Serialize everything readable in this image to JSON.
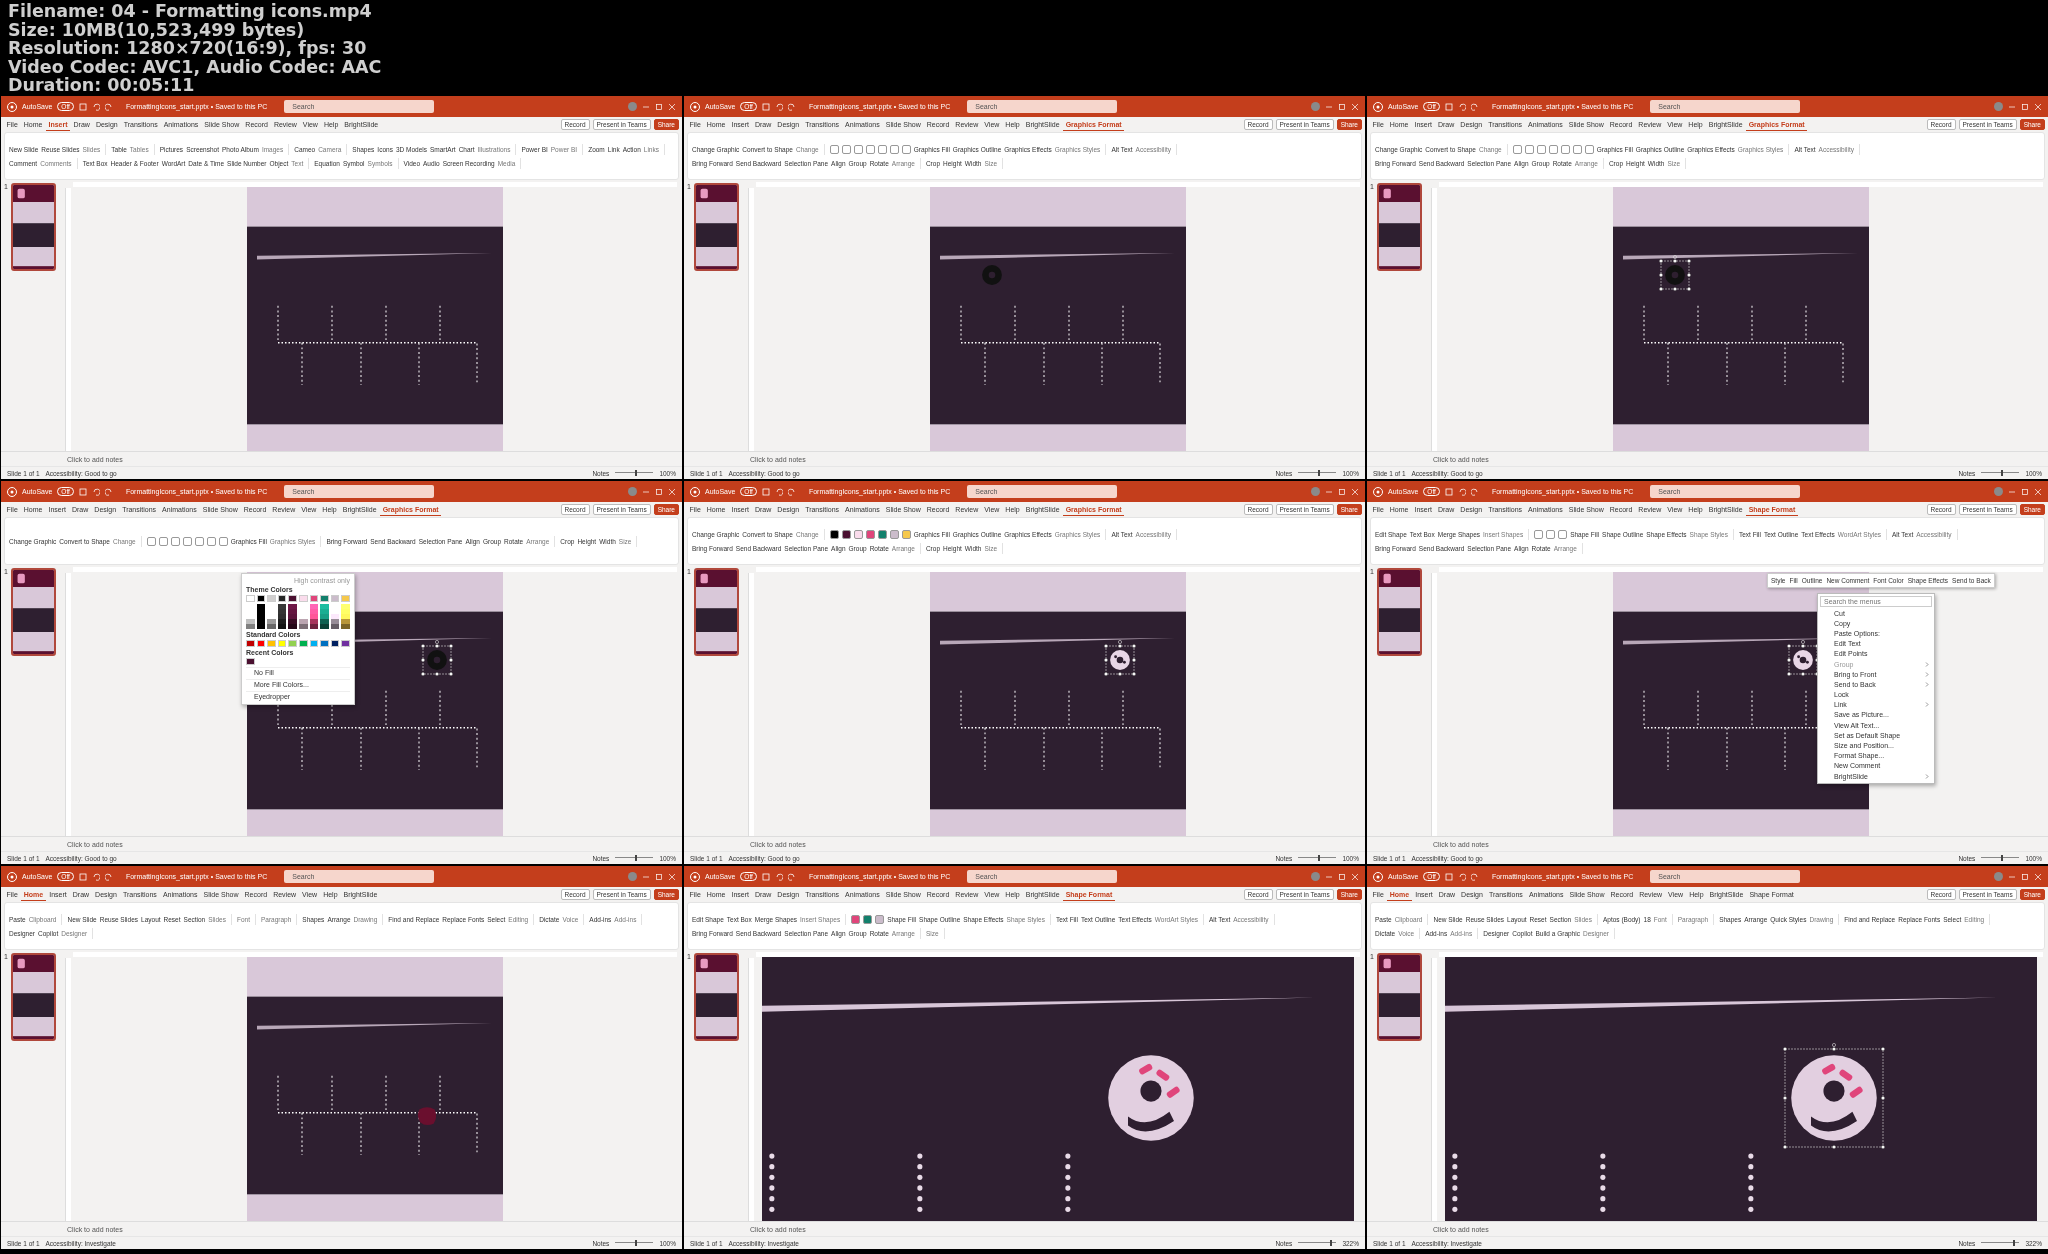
{
  "info_lines": [
    "Filename: 04 - Formatting icons.mp4",
    "Size: 10MB(10,523,499 bytes)",
    "Resolution: 1280×720(16:9), fps: 30",
    "Video Codec: AVC1, Audio Codec: AAC",
    "Duration: 00:05:11"
  ],
  "frames": [
    {
      "autosave": "AutoSave",
      "autosave_state": "Off",
      "title": "FormattingIcons_start.pptx • Saved to this PC",
      "search_placeholder": "Search",
      "tabs": [
        {
          "label": "File",
          "selected": false
        },
        {
          "label": "Home",
          "selected": false
        },
        {
          "label": "Insert",
          "selected": true
        },
        {
          "label": "Draw",
          "selected": false
        },
        {
          "label": "Design",
          "selected": false
        },
        {
          "label": "Transitions",
          "selected": false
        },
        {
          "label": "Animations",
          "selected": false
        },
        {
          "label": "Slide Show",
          "selected": false
        },
        {
          "label": "Record",
          "selected": false
        },
        {
          "label": "Review",
          "selected": false
        },
        {
          "label": "View",
          "selected": false
        },
        {
          "label": "Help",
          "selected": false
        },
        {
          "label": "BrightSlide",
          "selected": false
        }
      ],
      "actions": [
        "Record",
        "Present in Teams",
        "Share"
      ],
      "ribbon": [
        {
          "label": "Slides",
          "items": [
            "New Slide",
            "Reuse Slides"
          ]
        },
        {
          "label": "Tables",
          "items": [
            "Table"
          ]
        },
        {
          "label": "Images",
          "items": [
            "Pictures",
            "Screenshot",
            "Photo Album"
          ]
        },
        {
          "label": "Camera",
          "items": [
            "Cameo"
          ]
        },
        {
          "label": "Illustrations",
          "items": [
            "Shapes",
            "Icons",
            "3D Models",
            "SmartArt",
            "Chart"
          ]
        },
        {
          "label": "Power BI",
          "items": [
            "Power BI"
          ]
        },
        {
          "label": "Links",
          "items": [
            "Zoom",
            "Link",
            "Action"
          ]
        },
        {
          "label": "Comments",
          "items": [
            "Comment"
          ]
        },
        {
          "label": "Text",
          "items": [
            "Text Box",
            "Header & Footer",
            "WordArt",
            "Date & Time",
            "Slide Number",
            "Object"
          ]
        },
        {
          "label": "Symbols",
          "items": [
            "Equation",
            "Symbol"
          ]
        },
        {
          "label": "Media",
          "items": [
            "Video",
            "Audio",
            "Screen Recording"
          ]
        }
      ],
      "slide": {
        "kind": "fit"
      },
      "thumb_number": "1",
      "notes_placeholder": "Click to add notes",
      "slide_count": "Slide 1 of 1",
      "accessibility": "Accessibility: Good to go",
      "notes_button": "Notes",
      "zoom_slider": {
        "level": 0.55
      },
      "zoom": "100%"
    },
    {
      "autosave": "AutoSave",
      "autosave_state": "Off",
      "title": "FormattingIcons_start.pptx • Saved to this PC",
      "search_placeholder": "Search",
      "tabs": [
        {
          "label": "File",
          "selected": false
        },
        {
          "label": "Home",
          "selected": false
        },
        {
          "label": "Insert",
          "selected": false
        },
        {
          "label": "Draw",
          "selected": false
        },
        {
          "label": "Design",
          "selected": false
        },
        {
          "label": "Transitions",
          "selected": false
        },
        {
          "label": "Animations",
          "selected": false
        },
        {
          "label": "Slide Show",
          "selected": false
        },
        {
          "label": "Record",
          "selected": false
        },
        {
          "label": "Review",
          "selected": false
        },
        {
          "label": "View",
          "selected": false
        },
        {
          "label": "Help",
          "selected": false
        },
        {
          "label": "BrightSlide",
          "selected": false
        },
        {
          "label": "Graphics Format",
          "selected": true
        }
      ],
      "actions": [
        "Record",
        "Present in Teams",
        "Share"
      ],
      "ribbon": [
        {
          "label": "Change",
          "items": [
            "Change Graphic",
            "Convert to Shape"
          ]
        },
        {
          "label": "Graphics Styles",
          "swatches": [
            {
              "color": "#ffffff"
            },
            {
              "color": "#ffffff"
            },
            {
              "color": "#ffffff"
            },
            {
              "color": "#ffffff"
            },
            {
              "color": "#ffffff"
            },
            {
              "color": "#ffffff"
            },
            {
              "color": "#ffffff"
            }
          ],
          "items": [
            "Graphics Fill",
            "Graphics Outline",
            "Graphics Effects"
          ]
        },
        {
          "label": "Accessibility",
          "items": [
            "Alt Text"
          ]
        },
        {
          "label": "Arrange",
          "items": [
            "Bring Forward",
            "Send Backward",
            "Selection Pane",
            "Align",
            "Group",
            "Rotate"
          ]
        },
        {
          "label": "Size",
          "items": [
            "Crop",
            "Height",
            "Width"
          ]
        }
      ],
      "slide": {
        "kind": "fit",
        "icon": {
          "kind": "dark",
          "selected": false
        }
      },
      "thumb_number": "1",
      "notes_placeholder": "Click to add notes",
      "slide_count": "Slide 1 of 1",
      "accessibility": "Accessibility: Good to go",
      "notes_button": "Notes",
      "zoom_slider": {
        "level": 0.55
      },
      "zoom": "100%"
    },
    {
      "autosave": "AutoSave",
      "autosave_state": "Off",
      "title": "FormattingIcons_start.pptx • Saved to this PC",
      "search_placeholder": "Search",
      "tabs": [
        {
          "label": "File",
          "selected": false
        },
        {
          "label": "Home",
          "selected": false
        },
        {
          "label": "Insert",
          "selected": false
        },
        {
          "label": "Draw",
          "selected": false
        },
        {
          "label": "Design",
          "selected": false
        },
        {
          "label": "Transitions",
          "selected": false
        },
        {
          "label": "Animations",
          "selected": false
        },
        {
          "label": "Slide Show",
          "selected": false
        },
        {
          "label": "Record",
          "selected": false
        },
        {
          "label": "Review",
          "selected": false
        },
        {
          "label": "View",
          "selected": false
        },
        {
          "label": "Help",
          "selected": false
        },
        {
          "label": "BrightSlide",
          "selected": false
        },
        {
          "label": "Graphics Format",
          "selected": true
        }
      ],
      "actions": [
        "Record",
        "Present in Teams",
        "Share"
      ],
      "ribbon": [
        {
          "label": "Change",
          "items": [
            "Change Graphic",
            "Convert to Shape"
          ]
        },
        {
          "label": "Graphics Styles",
          "swatches": [
            {
              "color": "#ffffff"
            },
            {
              "color": "#ffffff"
            },
            {
              "color": "#ffffff"
            },
            {
              "color": "#ffffff"
            },
            {
              "color": "#ffffff"
            },
            {
              "color": "#ffffff"
            },
            {
              "color": "#ffffff"
            }
          ],
          "items": [
            "Graphics Fill",
            "Graphics Outline",
            "Graphics Effects"
          ]
        },
        {
          "label": "Accessibility",
          "items": [
            "Alt Text"
          ]
        },
        {
          "label": "Arrange",
          "items": [
            "Bring Forward",
            "Send Backward",
            "Selection Pane",
            "Align",
            "Group",
            "Rotate"
          ]
        },
        {
          "label": "Size",
          "items": [
            "Crop",
            "Height",
            "Width"
          ]
        }
      ],
      "slide": {
        "kind": "fit",
        "icon": {
          "kind": "dark",
          "selected": true
        }
      },
      "thumb_number": "1",
      "notes_placeholder": "Click to add notes",
      "slide_count": "Slide 1 of 1",
      "accessibility": "Accessibility: Good to go",
      "notes_button": "Notes",
      "zoom_slider": {
        "level": 0.55
      },
      "zoom": "100%"
    },
    {
      "autosave": "AutoSave",
      "autosave_state": "Off",
      "title": "FormattingIcons_start.pptx • Saved to this PC",
      "search_placeholder": "Search",
      "tabs": [
        {
          "label": "File",
          "selected": false
        },
        {
          "label": "Home",
          "selected": false
        },
        {
          "label": "Insert",
          "selected": false
        },
        {
          "label": "Draw",
          "selected": false
        },
        {
          "label": "Design",
          "selected": false
        },
        {
          "label": "Transitions",
          "selected": false
        },
        {
          "label": "Animations",
          "selected": false
        },
        {
          "label": "Slide Show",
          "selected": false
        },
        {
          "label": "Record",
          "selected": false
        },
        {
          "label": "Review",
          "selected": false
        },
        {
          "label": "View",
          "selected": false
        },
        {
          "label": "Help",
          "selected": false
        },
        {
          "label": "BrightSlide",
          "selected": false
        },
        {
          "label": "Graphics Format",
          "selected": true
        }
      ],
      "actions": [
        "Record",
        "Present in Teams",
        "Share"
      ],
      "ribbon": [
        {
          "label": "Change",
          "items": [
            "Change Graphic",
            "Convert to Shape"
          ]
        },
        {
          "label": "Graphics Styles",
          "swatches": [
            {
              "color": "#ffffff"
            },
            {
              "color": "#ffffff"
            },
            {
              "color": "#ffffff"
            },
            {
              "color": "#ffffff"
            },
            {
              "color": "#ffffff"
            },
            {
              "color": "#ffffff"
            },
            {
              "color": "#ffffff"
            }
          ],
          "items": [
            "Graphics Fill"
          ]
        },
        {
          "label": "Arrange",
          "items": [
            "Bring Forward",
            "Send Backward",
            "Selection Pane",
            "Align",
            "Group",
            "Rotate"
          ]
        },
        {
          "label": "Size",
          "items": [
            "Crop",
            "Height",
            "Width"
          ]
        }
      ],
      "slide": {
        "kind": "fit",
        "icon": {
          "kind": "dark",
          "selected": true
        }
      },
      "thumb_number": "1",
      "notes_placeholder": "Click to add notes",
      "slide_count": "Slide 1 of 1",
      "accessibility": "Accessibility: Good to go",
      "notes_button": "Notes",
      "zoom_slider": {
        "level": 0.55
      },
      "zoom": "100%",
      "popup": {
        "kind": "palette",
        "toggle_label": "High contrast only",
        "theme_heading": "Theme Colors",
        "theme_colors": [
          {
            "color": "#ffffff"
          },
          {
            "color": "#000000"
          },
          {
            "color": "#d0cece"
          },
          {
            "color": "#262626"
          },
          {
            "color": "#4a1030"
          },
          {
            "color": "#fadcec"
          },
          {
            "color": "#e0457b"
          },
          {
            "color": "#13806c"
          },
          {
            "color": "#cbbccb"
          },
          {
            "color": "#f5c84c"
          }
        ],
        "standard_heading": "Standard Colors",
        "standard_colors": [
          {
            "color": "#c00000"
          },
          {
            "color": "#ff0000"
          },
          {
            "color": "#ffc000"
          },
          {
            "color": "#ffff00"
          },
          {
            "color": "#92d050"
          },
          {
            "color": "#00b050"
          },
          {
            "color": "#00b0f0"
          },
          {
            "color": "#0070c0"
          },
          {
            "color": "#002060"
          },
          {
            "color": "#7030a0"
          }
        ],
        "recent_heading": "Recent Colors",
        "recent_colors": [
          {
            "color": "#4a1030"
          }
        ],
        "commands": [
          "No Fill",
          "More Fill Colors...",
          "Eyedropper"
        ]
      }
    },
    {
      "autosave": "AutoSave",
      "autosave_state": "Off",
      "title": "FormattingIcons_start.pptx • Saved to this PC",
      "search_placeholder": "Search",
      "tabs": [
        {
          "label": "File",
          "selected": false
        },
        {
          "label": "Home",
          "selected": false
        },
        {
          "label": "Insert",
          "selected": false
        },
        {
          "label": "Draw",
          "selected": false
        },
        {
          "label": "Design",
          "selected": false
        },
        {
          "label": "Transitions",
          "selected": false
        },
        {
          "label": "Animations",
          "selected": false
        },
        {
          "label": "Slide Show",
          "selected": false
        },
        {
          "label": "Record",
          "selected": false
        },
        {
          "label": "Review",
          "selected": false
        },
        {
          "label": "View",
          "selected": false
        },
        {
          "label": "Help",
          "selected": false
        },
        {
          "label": "BrightSlide",
          "selected": false
        },
        {
          "label": "Graphics Format",
          "selected": true
        }
      ],
      "actions": [
        "Record",
        "Present in Teams",
        "Share"
      ],
      "ribbon": [
        {
          "label": "Change",
          "items": [
            "Change Graphic",
            "Convert to Shape"
          ]
        },
        {
          "label": "Graphics Styles",
          "swatches": [
            {
              "color": "#000000"
            },
            {
              "color": "#4a1030"
            },
            {
              "color": "#fadcec"
            },
            {
              "color": "#e0457b"
            },
            {
              "color": "#13806c"
            },
            {
              "color": "#cbbccb"
            },
            {
              "color": "#f5c84c"
            }
          ],
          "items": [
            "Graphics Fill",
            "Graphics Outline",
            "Graphics Effects"
          ]
        },
        {
          "label": "Accessibility",
          "items": [
            "Alt Text"
          ]
        },
        {
          "label": "Arrange",
          "items": [
            "Bring Forward",
            "Send Backward",
            "Selection Pane",
            "Align",
            "Group",
            "Rotate"
          ]
        },
        {
          "label": "Size",
          "items": [
            "Crop",
            "Height",
            "Width"
          ]
        }
      ],
      "slide": {
        "kind": "fit",
        "icon": {
          "kind": "light",
          "selected": true
        }
      },
      "thumb_number": "1",
      "notes_placeholder": "Click to add notes",
      "slide_count": "Slide 1 of 1",
      "accessibility": "Accessibility: Good to go",
      "notes_button": "Notes",
      "zoom_slider": {
        "level": 0.55
      },
      "zoom": "100%"
    },
    {
      "autosave": "AutoSave",
      "autosave_state": "Off",
      "title": "FormattingIcons_start.pptx • Saved to this PC",
      "search_placeholder": "Search",
      "tabs": [
        {
          "label": "File",
          "selected": false
        },
        {
          "label": "Home",
          "selected": false
        },
        {
          "label": "Insert",
          "selected": false
        },
        {
          "label": "Draw",
          "selected": false
        },
        {
          "label": "Design",
          "selected": false
        },
        {
          "label": "Transitions",
          "selected": false
        },
        {
          "label": "Animations",
          "selected": false
        },
        {
          "label": "Slide Show",
          "selected": false
        },
        {
          "label": "Record",
          "selected": false
        },
        {
          "label": "Review",
          "selected": false
        },
        {
          "label": "View",
          "selected": false
        },
        {
          "label": "Help",
          "selected": false
        },
        {
          "label": "BrightSlide",
          "selected": false
        },
        {
          "label": "Shape Format",
          "selected": true
        }
      ],
      "actions": [
        "Record",
        "Present in Teams",
        "Share"
      ],
      "ribbon": [
        {
          "label": "Insert Shapes",
          "items": [
            "Edit Shape",
            "Text Box",
            "Merge Shapes"
          ]
        },
        {
          "label": "Shape Styles",
          "swatches": [
            {
              "color": "#ffffff"
            },
            {
              "color": "#ffffff"
            },
            {
              "color": "#ffffff"
            }
          ],
          "items": [
            "Shape Fill",
            "Shape Outline",
            "Shape Effects"
          ]
        },
        {
          "label": "WordArt Styles",
          "items": [
            "Text Fill",
            "Text Outline",
            "Text Effects"
          ]
        },
        {
          "label": "Accessibility",
          "items": [
            "Alt Text"
          ]
        },
        {
          "label": "Arrange",
          "items": [
            "Bring Forward",
            "Send Backward",
            "Selection Pane",
            "Align",
            "Rotate"
          ]
        }
      ],
      "slide": {
        "kind": "fit",
        "icon": {
          "kind": "light",
          "selected": true
        }
      },
      "thumb_number": "1",
      "notes_placeholder": "Click to add notes",
      "slide_count": "Slide 1 of 1",
      "accessibility": "Accessibility: Good to go",
      "notes_button": "Notes",
      "zoom_slider": {
        "level": 0.55
      },
      "zoom": "100%",
      "popup": {
        "kind": "context_menu",
        "mini_toolbar": [
          "Style",
          "Fill",
          "Outline",
          "New Comment",
          "Font Color",
          "Shape Effects",
          "Send to Back"
        ],
        "search_placeholder": "Search the menus",
        "items": [
          {
            "label": "Cut",
            "disabled": false,
            "submenu": false
          },
          {
            "label": "Copy",
            "disabled": false,
            "submenu": false
          },
          {
            "label": "Paste Options:",
            "disabled": false,
            "submenu": false
          },
          {
            "label": "Edit Text",
            "disabled": false,
            "submenu": false
          },
          {
            "label": "Edit Points",
            "disabled": false,
            "submenu": false
          },
          {
            "label": "Group",
            "disabled": true,
            "submenu": true
          },
          {
            "label": "Bring to Front",
            "disabled": false,
            "submenu": true
          },
          {
            "label": "Send to Back",
            "disabled": false,
            "submenu": true
          },
          {
            "label": "Lock",
            "disabled": false,
            "submenu": false
          },
          {
            "label": "Link",
            "disabled": false,
            "submenu": true
          },
          {
            "label": "Save as Picture...",
            "disabled": false,
            "submenu": false
          },
          {
            "label": "View Alt Text...",
            "disabled": false,
            "submenu": false
          },
          {
            "label": "Set as Default Shape",
            "disabled": false,
            "submenu": false
          },
          {
            "label": "Size and Position...",
            "disabled": false,
            "submenu": false
          },
          {
            "label": "Format Shape...",
            "disabled": false,
            "submenu": false
          },
          {
            "label": "New Comment",
            "disabled": false,
            "submenu": false
          },
          {
            "label": "BrightSlide",
            "disabled": false,
            "submenu": true
          }
        ]
      }
    },
    {
      "autosave": "AutoSave",
      "autosave_state": "Off",
      "title": "FormattingIcons_start.pptx • Saved to this PC",
      "search_placeholder": "Search",
      "tabs": [
        {
          "label": "File",
          "selected": false
        },
        {
          "label": "Home",
          "selected": true
        },
        {
          "label": "Insert",
          "selected": false
        },
        {
          "label": "Draw",
          "selected": false
        },
        {
          "label": "Design",
          "selected": false
        },
        {
          "label": "Transitions",
          "selected": false
        },
        {
          "label": "Animations",
          "selected": false
        },
        {
          "label": "Slide Show",
          "selected": false
        },
        {
          "label": "Record",
          "selected": false
        },
        {
          "label": "Review",
          "selected": false
        },
        {
          "label": "View",
          "selected": false
        },
        {
          "label": "Help",
          "selected": false
        },
        {
          "label": "BrightSlide",
          "selected": false
        }
      ],
      "actions": [
        "Record",
        "Present in Teams",
        "Share"
      ],
      "ribbon": [
        {
          "label": "Clipboard",
          "items": [
            "Paste"
          ]
        },
        {
          "label": "Slides",
          "items": [
            "New Slide",
            "Reuse Slides",
            "Layout",
            "Reset",
            "Section"
          ]
        },
        {
          "label": "Font"
        },
        {
          "label": "Paragraph"
        },
        {
          "label": "Drawing",
          "items": [
            "Shapes",
            "Arrange"
          ]
        },
        {
          "label": "Editing",
          "items": [
            "Find and Replace",
            "Replace Fonts",
            "Select"
          ]
        },
        {
          "label": "Voice",
          "items": [
            "Dictate"
          ]
        },
        {
          "label": "Add-ins",
          "items": [
            "Add-ins"
          ]
        },
        {
          "label": "Designer",
          "items": [
            "Designer",
            "Copilot"
          ]
        }
      ],
      "slide": {
        "kind": "fit",
        "icon": {
          "kind": "blob",
          "selected": false
        }
      },
      "thumb_number": "1",
      "notes_placeholder": "Click to add notes",
      "slide_count": "Slide 1 of 1",
      "accessibility": "Accessibility: Investigate",
      "notes_button": "Notes",
      "zoom_slider": {
        "level": 0.55
      },
      "zoom": "100%"
    },
    {
      "autosave": "AutoSave",
      "autosave_state": "Off",
      "title": "FormattingIcons_start.pptx • Saved to this PC",
      "search_placeholder": "Search",
      "tabs": [
        {
          "label": "File",
          "selected": false
        },
        {
          "label": "Home",
          "selected": false
        },
        {
          "label": "Insert",
          "selected": false
        },
        {
          "label": "Draw",
          "selected": false
        },
        {
          "label": "Design",
          "selected": false
        },
        {
          "label": "Transitions",
          "selected": false
        },
        {
          "label": "Animations",
          "selected": false
        },
        {
          "label": "Slide Show",
          "selected": false
        },
        {
          "label": "Record",
          "selected": false
        },
        {
          "label": "Review",
          "selected": false
        },
        {
          "label": "View",
          "selected": false
        },
        {
          "label": "Help",
          "selected": false
        },
        {
          "label": "BrightSlide",
          "selected": false
        },
        {
          "label": "Shape Format",
          "selected": true
        }
      ],
      "actions": [
        "Record",
        "Present in Teams",
        "Share"
      ],
      "ribbon": [
        {
          "label": "Insert Shapes",
          "items": [
            "Edit Shape",
            "Text Box",
            "Merge Shapes"
          ]
        },
        {
          "label": "Shape Styles",
          "swatches": [
            {
              "color": "#e0457b"
            },
            {
              "color": "#13806c"
            },
            {
              "color": "#cbbccb"
            }
          ],
          "items": [
            "Shape Fill",
            "Shape Outline",
            "Shape Effects"
          ]
        },
        {
          "label": "WordArt Styles",
          "items": [
            "Text Fill",
            "Text Outline",
            "Text Effects"
          ]
        },
        {
          "label": "Accessibility",
          "items": [
            "Alt Text"
          ]
        },
        {
          "label": "Arrange",
          "items": [
            "Bring Forward",
            "Send Backward",
            "Selection Pane",
            "Align",
            "Group",
            "Rotate"
          ]
        },
        {
          "label": "Size"
        }
      ],
      "slide": {
        "kind": "zoomed",
        "icon": {
          "kind": "donut",
          "selected": false
        }
      },
      "thumb_number": "1",
      "notes_placeholder": "Click to add notes",
      "slide_count": "Slide 1 of 1",
      "accessibility": "Accessibility: Investigate",
      "notes_button": "Notes",
      "zoom_slider": {
        "level": 0.85
      },
      "zoom": "322%"
    },
    {
      "autosave": "AutoSave",
      "autosave_state": "Off",
      "title": "FormattingIcons_start.pptx • Saved to this PC",
      "search_placeholder": "Search",
      "tabs": [
        {
          "label": "File",
          "selected": false
        },
        {
          "label": "Home",
          "selected": true
        },
        {
          "label": "Insert",
          "selected": false
        },
        {
          "label": "Draw",
          "selected": false
        },
        {
          "label": "Design",
          "selected": false
        },
        {
          "label": "Transitions",
          "selected": false
        },
        {
          "label": "Animations",
          "selected": false
        },
        {
          "label": "Slide Show",
          "selected": false
        },
        {
          "label": "Record",
          "selected": false
        },
        {
          "label": "Review",
          "selected": false
        },
        {
          "label": "View",
          "selected": false
        },
        {
          "label": "Help",
          "selected": false
        },
        {
          "label": "BrightSlide",
          "selected": false
        },
        {
          "label": "Shape Format",
          "selected": false
        }
      ],
      "actions": [
        "Record",
        "Present in Teams",
        "Share"
      ],
      "ribbon": [
        {
          "label": "Clipboard",
          "items": [
            "Paste"
          ]
        },
        {
          "label": "Slides",
          "items": [
            "New Slide",
            "Reuse Slides",
            "Layout",
            "Reset",
            "Section"
          ]
        },
        {
          "label": "Font",
          "items": [
            "Aptos (Body)",
            "18"
          ]
        },
        {
          "label": "Paragraph"
        },
        {
          "label": "Drawing",
          "items": [
            "Shapes",
            "Arrange",
            "Quick Styles"
          ]
        },
        {
          "label": "Editing",
          "items": [
            "Find and Replace",
            "Replace Fonts",
            "Select"
          ]
        },
        {
          "label": "Voice",
          "items": [
            "Dictate"
          ]
        },
        {
          "label": "Add-ins",
          "items": [
            "Add-ins"
          ]
        },
        {
          "label": "Designer",
          "items": [
            "Designer",
            "Copilot",
            "Build a Graphic"
          ]
        }
      ],
      "slide": {
        "kind": "zoomed",
        "icon": {
          "kind": "donut",
          "selected": true
        }
      },
      "thumb_number": "1",
      "notes_placeholder": "Click to add notes",
      "slide_count": "Slide 1 of 1",
      "accessibility": "Accessibility: Investigate",
      "notes_button": "Notes",
      "zoom_slider": {
        "level": 0.85
      },
      "zoom": "322%"
    }
  ]
}
